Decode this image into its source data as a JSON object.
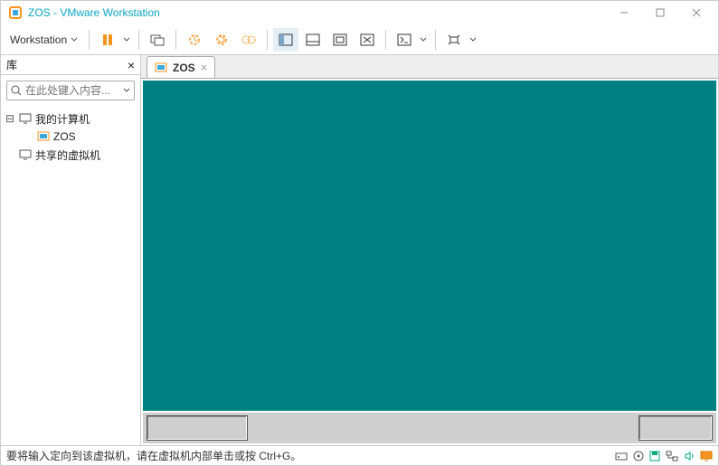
{
  "titlebar": {
    "title": "ZOS - VMware Workstation"
  },
  "toolbar": {
    "menu_label": "Workstation"
  },
  "sidebar": {
    "header": "库",
    "search_placeholder": "在此处键入内容...",
    "tree": {
      "root": "我的计算机",
      "vm": "ZOS",
      "shared": "共享的虚拟机"
    }
  },
  "tab": {
    "label": "ZOS"
  },
  "statusbar": {
    "message": "要将输入定向到该虚拟机，请在虚拟机内部单击或按 Ctrl+G。"
  }
}
